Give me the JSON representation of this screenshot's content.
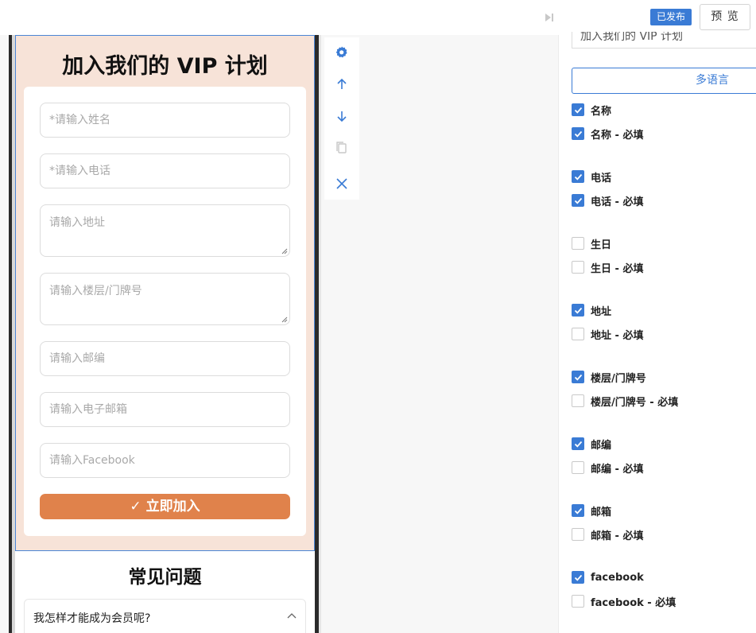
{
  "header": {
    "status_badge": "已发布",
    "preview_label": "预 览"
  },
  "form": {
    "title": "加入我们的 VIP 计划",
    "fields": [
      {
        "placeholder": "*请输入姓名"
      },
      {
        "placeholder": "*请输入电话"
      },
      {
        "placeholder": "请输入地址"
      },
      {
        "placeholder": "请输入楼层/门牌号"
      },
      {
        "placeholder": "请输入邮编"
      },
      {
        "placeholder": "请输入电子邮箱"
      },
      {
        "placeholder": "请输入Facebook"
      }
    ],
    "submit_label": "✓ 立即加入"
  },
  "faq": {
    "title": "常见问题",
    "items": [
      {
        "question": "我怎样才能成为会员呢?"
      }
    ]
  },
  "toolbar": {
    "icons": [
      "gear-icon",
      "arrow-up-icon",
      "arrow-down-icon",
      "copy-icon",
      "close-icon"
    ]
  },
  "properties": {
    "name_value": "加入我们的 VIP 计划",
    "multilang_label": "多语言",
    "options": [
      {
        "label": "名称",
        "checked": true
      },
      {
        "label": "名称 - 必填",
        "checked": true
      },
      {
        "label": "电话",
        "checked": true
      },
      {
        "label": "电话 - 必填",
        "checked": true
      },
      {
        "label": "生日",
        "checked": false
      },
      {
        "label": "生日 - 必填",
        "checked": false
      },
      {
        "label": "地址",
        "checked": true
      },
      {
        "label": "地址 - 必填",
        "checked": false
      },
      {
        "label": "楼层/门牌号",
        "checked": true
      },
      {
        "label": "楼层/门牌号 - 必填",
        "checked": false
      },
      {
        "label": "邮编",
        "checked": true
      },
      {
        "label": "邮编 - 必填",
        "checked": false
      },
      {
        "label": "邮箱",
        "checked": true
      },
      {
        "label": "邮箱 - 必填",
        "checked": false
      },
      {
        "label": "facebook",
        "checked": true
      },
      {
        "label": "facebook - 必填",
        "checked": false
      }
    ]
  },
  "colors": {
    "accent": "#3a7bd5",
    "submit": "#e0824b",
    "vip_bg": "#f7e3d8"
  }
}
